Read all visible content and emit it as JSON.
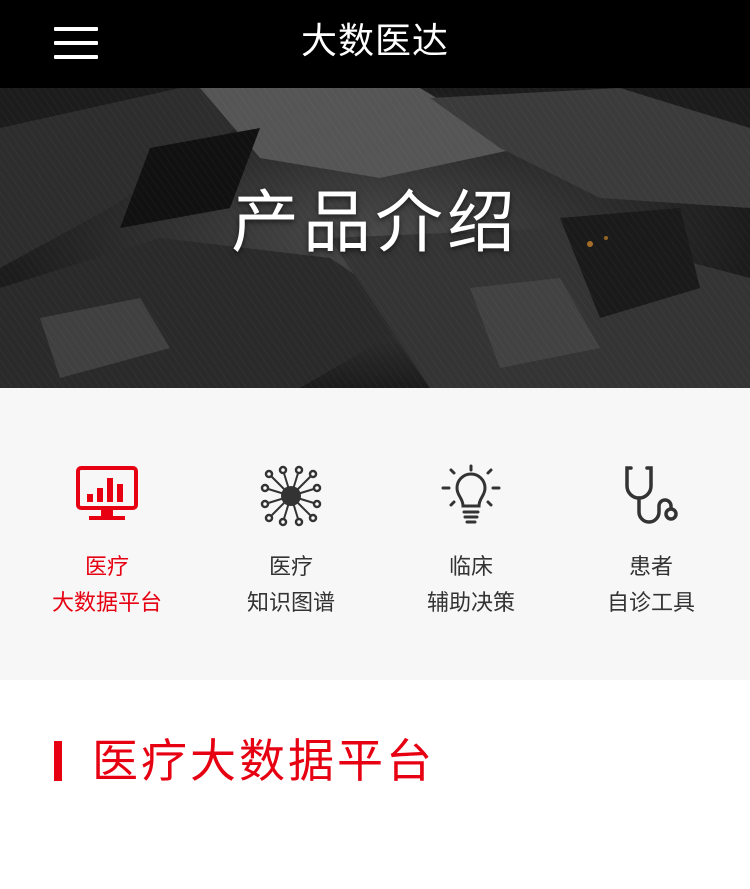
{
  "header": {
    "title": "大数医达",
    "menu_icon": "hamburger-menu-icon"
  },
  "hero": {
    "title": "产品介绍"
  },
  "nav": {
    "accent_color": "#e60012",
    "items": [
      {
        "icon": "monitor-bar-chart-icon",
        "line1": "医疗",
        "line2": "大数据平台",
        "active": true
      },
      {
        "icon": "knowledge-graph-icon",
        "line1": "医疗",
        "line2": "知识图谱",
        "active": false
      },
      {
        "icon": "lightbulb-icon",
        "line1": "临床",
        "line2": "辅助决策",
        "active": false
      },
      {
        "icon": "stethoscope-icon",
        "line1": "患者",
        "line2": "自诊工具",
        "active": false
      }
    ]
  },
  "section": {
    "title": "医疗大数据平台"
  }
}
